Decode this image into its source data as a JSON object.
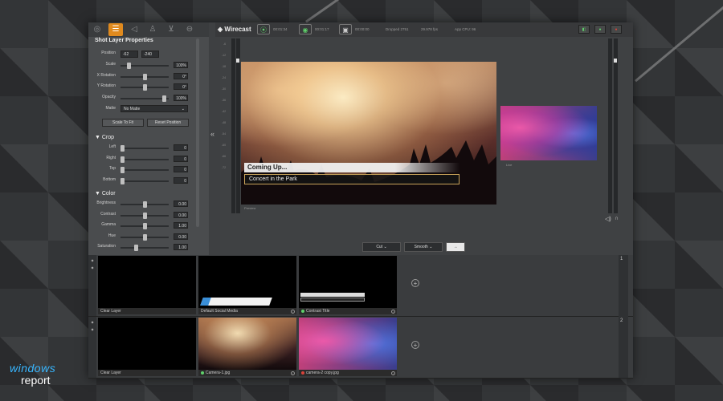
{
  "properties": {
    "title": "Shot Layer Properties",
    "position_label": "Position",
    "position_x": "-62",
    "position_y": "-240",
    "rows": [
      {
        "label": "Scale",
        "value": "100%",
        "level": 0.15
      },
      {
        "label": "X Rotation",
        "value": "0°",
        "level": 0.5
      },
      {
        "label": "Y Rotation",
        "value": "0°",
        "level": 0.5
      },
      {
        "label": "Opacity",
        "value": "100%",
        "level": 0.95
      }
    ],
    "matte_label": "Matte",
    "matte_value": "No Matte",
    "scale_to_fit": "Scale To Fit",
    "reset_position": "Reset Position",
    "crop_title": "Crop",
    "crop": [
      {
        "label": "Left",
        "value": "0",
        "level": 0
      },
      {
        "label": "Right",
        "value": "0",
        "level": 0
      },
      {
        "label": "Top",
        "value": "0",
        "level": 0
      },
      {
        "label": "Bottom",
        "value": "0",
        "level": 0
      }
    ],
    "color_title": "Color",
    "color": [
      {
        "label": "Brightness",
        "value": "0.00",
        "level": 0.5
      },
      {
        "label": "Contrast",
        "value": "0.00",
        "level": 0.5
      },
      {
        "label": "Gamma",
        "value": "1.00",
        "level": 0.5
      },
      {
        "label": "Hue",
        "value": "0.00",
        "level": 0.5
      },
      {
        "label": "Saturation",
        "value": "1.00",
        "level": 0.3
      }
    ]
  },
  "header": {
    "app_name": "Wirecast",
    "stream_time": "00:01:34",
    "record_time": "00:01:17",
    "disk_time": "00:00:00",
    "dropped": "Dropped 2751",
    "fps": "29.978 fps",
    "cpu": "App CPU: 96"
  },
  "preview": {
    "coming_up": "Coming Up...",
    "title": "Concert in the Park",
    "preview_label": "Preview",
    "live_label": "Live"
  },
  "transition": {
    "cut": "Cut",
    "smooth": "Smooth",
    "go": "→"
  },
  "layers": [
    {
      "number": "1",
      "shots": [
        {
          "label": "Clear Layer",
          "status": "none"
        },
        {
          "label": "Default Social Media",
          "status": "none"
        },
        {
          "label": "Contrast Title",
          "status": "green"
        }
      ]
    },
    {
      "number": "2",
      "shots": [
        {
          "label": "Clear Layer",
          "status": "none"
        },
        {
          "label": "Camera-1.jpg",
          "status": "green"
        },
        {
          "label": "camera-2 copy.jpg",
          "status": "red"
        }
      ]
    }
  ],
  "watermark": {
    "line1": "windows",
    "line2": "report"
  },
  "colors": {
    "accent": "#e08a1e",
    "go_green": "#5fd06b",
    "record_red": "#d9433a"
  }
}
